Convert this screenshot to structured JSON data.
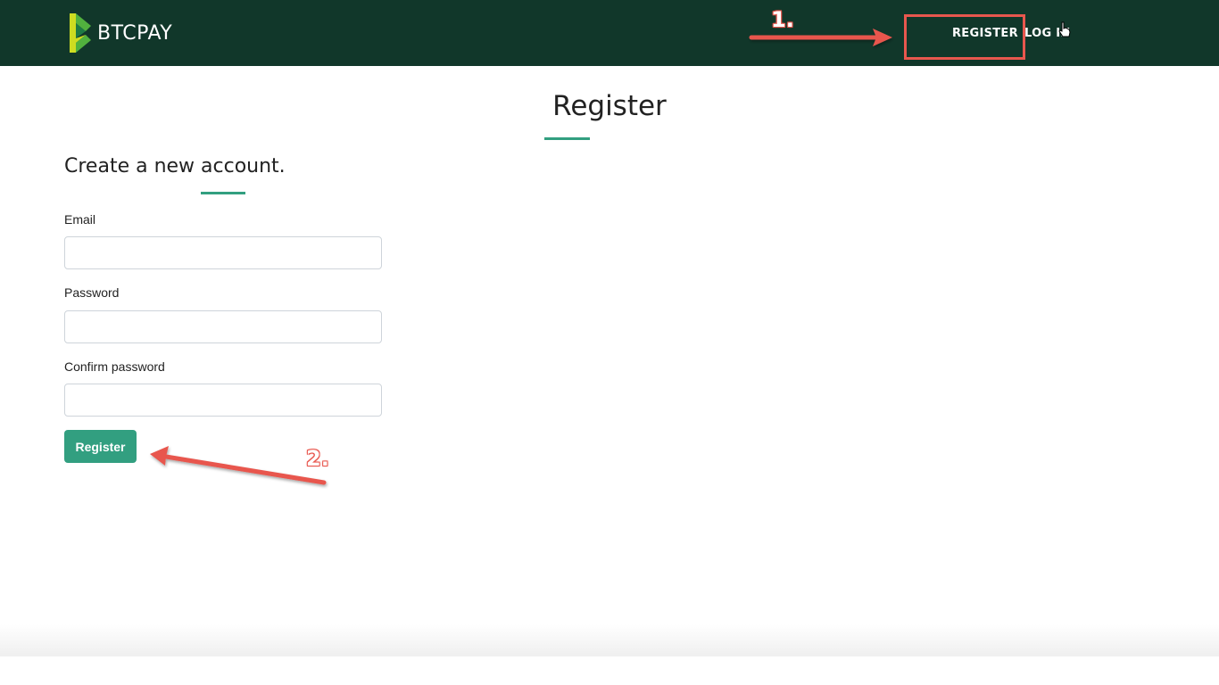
{
  "navbar": {
    "brand_name": "BTCPAY",
    "links": [
      {
        "label": "REGISTER"
      },
      {
        "label": "LOG IN"
      }
    ],
    "background_color": "#11372a",
    "logo_icon": "btcpay-logo-icon",
    "cursor_icon": "hand-pointer-icon"
  },
  "page": {
    "title": "Register",
    "subtitle": "Create a new account.",
    "accent_color": "#329f80"
  },
  "form": {
    "fields": [
      {
        "label": "Email",
        "value": "",
        "placeholder": ""
      },
      {
        "label": "Password",
        "value": "",
        "placeholder": ""
      },
      {
        "label": "Confirm password",
        "value": "",
        "placeholder": ""
      }
    ],
    "submit_label": "Register"
  },
  "annotations": {
    "color": "#e8574e",
    "steps": [
      {
        "label": "1."
      },
      {
        "label": "2."
      }
    ]
  }
}
